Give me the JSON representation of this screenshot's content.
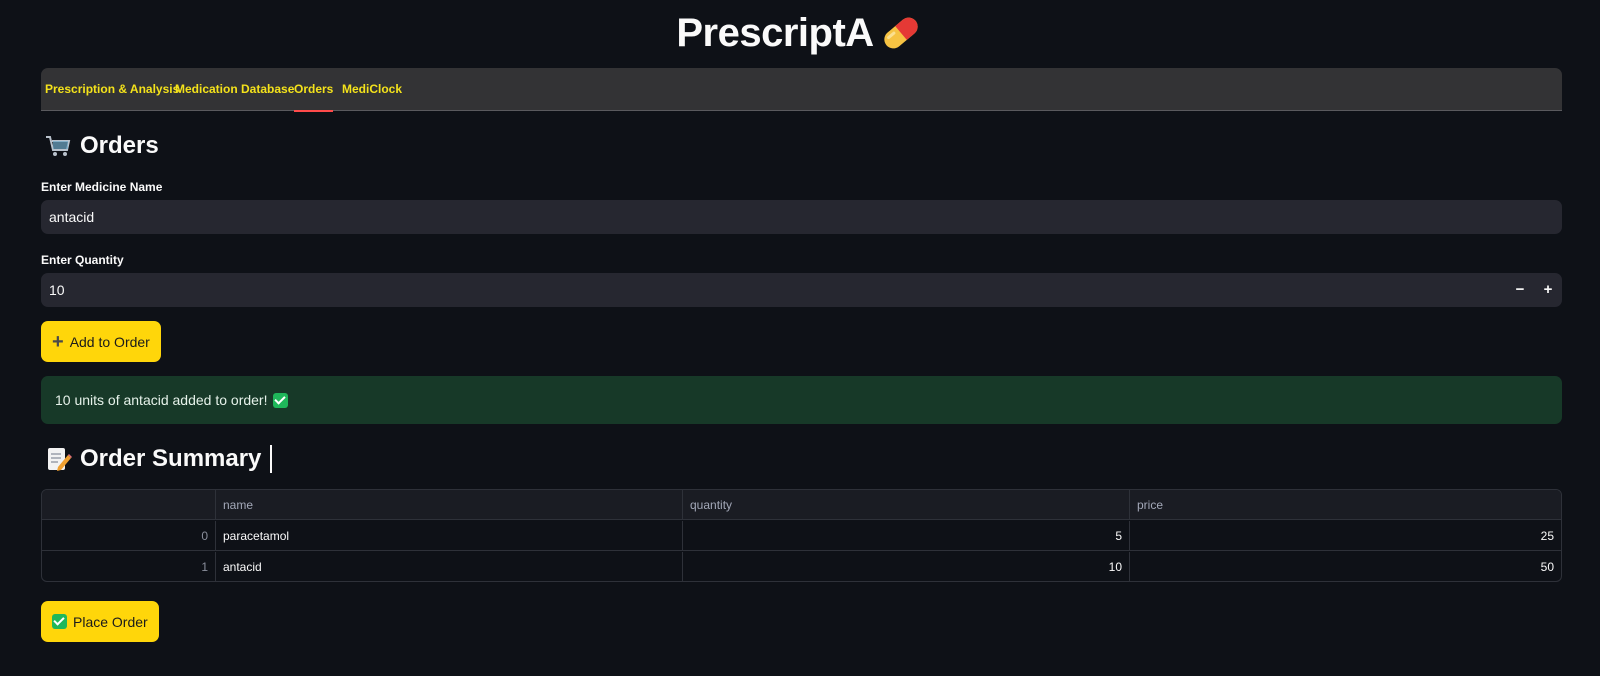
{
  "app": {
    "title": "PrescriptA",
    "title_icon": "pill-icon"
  },
  "tabs": [
    {
      "label": "Prescription & Analysis",
      "active": false
    },
    {
      "label": "Medication Database",
      "active": false
    },
    {
      "label": "Orders",
      "active": true
    },
    {
      "label": "MediClock",
      "active": false
    }
  ],
  "orders": {
    "heading": "Orders",
    "heading_icon": "shopping-cart-icon",
    "medicine_label": "Enter Medicine Name",
    "medicine_value": "antacid",
    "quantity_label": "Enter Quantity",
    "quantity_value": "10",
    "decrement_label": "−",
    "increment_label": "+",
    "add_button_label": "Add to Order",
    "success_message": "10 units of antacid added to order!"
  },
  "summary": {
    "heading": "Order Summary",
    "heading_icon": "memo-icon",
    "columns": [
      "",
      "name",
      "quantity",
      "price"
    ],
    "rows": [
      {
        "index": "0",
        "name": "paracetamol",
        "quantity": "5",
        "price": "25"
      },
      {
        "index": "1",
        "name": "antacid",
        "quantity": "10",
        "price": "50"
      }
    ],
    "place_order_label": "Place Order"
  },
  "colors": {
    "background": "#0e1117",
    "tab_text": "#f4e21b",
    "active_tab_underline": "#ff4b4b",
    "button": "#ffd60a",
    "success_bg": "#173928"
  }
}
